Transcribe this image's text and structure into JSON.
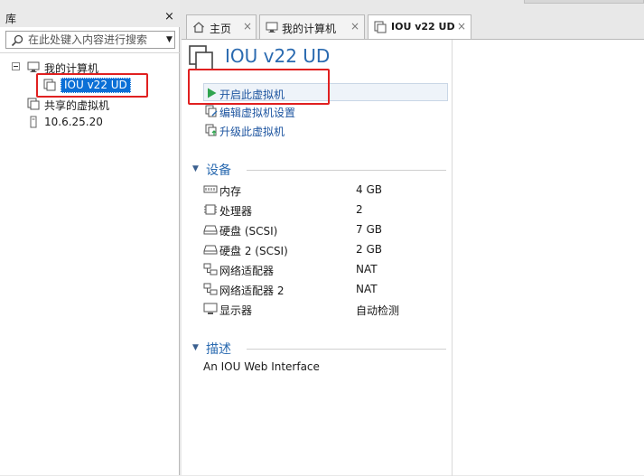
{
  "library": {
    "title": "库",
    "close_label": "×",
    "search_placeholder": "在此处键入内容进行搜索",
    "tree": [
      {
        "label": "我的计算机"
      },
      {
        "label": "IOU v22 UD",
        "selected": true
      },
      {
        "label": "共享的虚拟机"
      },
      {
        "label": "10.6.25.20"
      }
    ]
  },
  "tabs": [
    {
      "label": "主页",
      "icon": "home-icon"
    },
    {
      "label": "我的计算机",
      "icon": "monitor-icon"
    },
    {
      "label": "IOU v22 UD",
      "icon": "vm-icon",
      "active": true
    }
  ],
  "tab_close_label": "×",
  "vm": {
    "title": "IOU v22 UD",
    "actions": [
      {
        "label": "开启此虚拟机",
        "icon": "play-icon"
      },
      {
        "label": "编辑虚拟机设置",
        "icon": "edit-settings-icon"
      },
      {
        "label": "升级此虚拟机",
        "icon": "upgrade-icon"
      }
    ],
    "devices_title": "设备",
    "devices": [
      {
        "name": "内存",
        "value": "4 GB",
        "icon": "memory-icon"
      },
      {
        "name": "处理器",
        "value": "2",
        "icon": "cpu-icon"
      },
      {
        "name": "硬盘 (SCSI)",
        "value": "7 GB",
        "icon": "harddisk-icon"
      },
      {
        "name": "硬盘 2 (SCSI)",
        "value": "2 GB",
        "icon": "harddisk-icon"
      },
      {
        "name": "网络适配器",
        "value": "NAT",
        "icon": "network-icon"
      },
      {
        "name": "网络适配器 2",
        "value": "NAT",
        "icon": "network-icon"
      },
      {
        "name": "显示器",
        "value": "自动检测",
        "icon": "display-icon"
      }
    ],
    "description_title": "描述",
    "description": "An IOU Web Interface"
  },
  "colors": {
    "accent": "#2a6ab0",
    "selection": "#0b6fd6",
    "highlight_box": "#e02020",
    "play_green": "#2fa44f"
  }
}
